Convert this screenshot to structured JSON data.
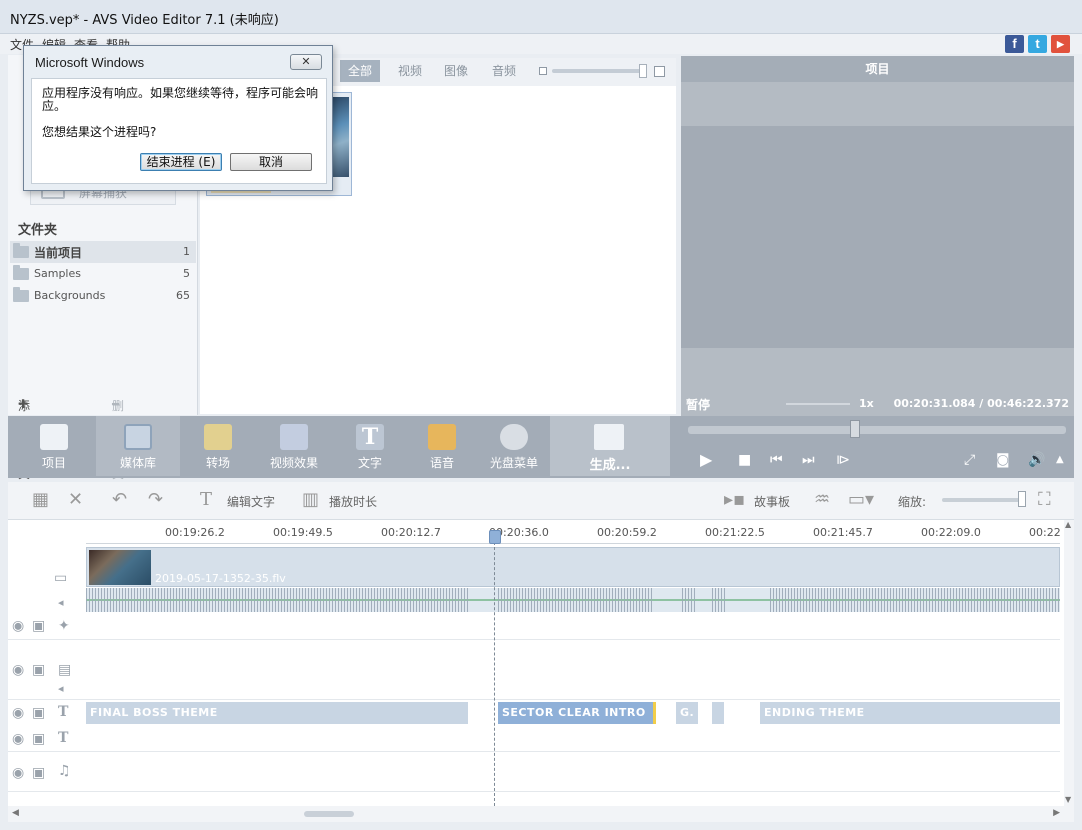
{
  "window": {
    "title": "NYZS.vep* - AVS Video Editor 7.1 (未响应)"
  },
  "menu": [
    "文件",
    "编辑",
    "查看",
    "帮助"
  ],
  "social": [
    {
      "icon": "facebook-icon",
      "glyph": "f",
      "color": "#3b5998"
    },
    {
      "icon": "twitter-icon",
      "glyph": "t",
      "color": "#35a8e0"
    },
    {
      "icon": "youtube-icon",
      "glyph": "▶",
      "color": "#e1523d"
    }
  ],
  "left_panel": {
    "record_button": "屏幕捕获",
    "folders_header": "文件夹",
    "folders": [
      {
        "name": "当前项目",
        "count": "1"
      },
      {
        "name": "Samples",
        "count": "5"
      },
      {
        "name": "Backgrounds",
        "count": "65"
      }
    ],
    "add_folder": "添加文件夹",
    "delete_folder": "删除文件夹"
  },
  "media": {
    "tabs": [
      "全部",
      "视频",
      "图像",
      "音频"
    ]
  },
  "preview": {
    "title": "项目",
    "status": "暂停",
    "speed": "1x",
    "time": "00:20:31.084  /  00:46:22.372"
  },
  "tools": [
    "项目",
    "媒体库",
    "转场",
    "视频效果",
    "文字",
    "语音",
    "光盘菜单"
  ],
  "generate": "生成...",
  "timeline_tools": {
    "edit_text": "编辑文字",
    "duration": "播放时长",
    "storyboard": "故事板",
    "zoom": "缩放:"
  },
  "ruler": [
    "00:19:26.2",
    "00:19:49.5",
    "00:20:12.7",
    "00:20:36.0",
    "00:20:59.2",
    "00:21:22.5",
    "00:21:45.7",
    "00:22:09.0",
    "00:22"
  ],
  "video_clip": "2019-05-17-1352-35.flv",
  "text_clips": [
    "FINAL BOSS THEME",
    "SECTOR CLEAR INTRO",
    "G.",
    "ENDING THEME"
  ],
  "dialog": {
    "title": "Microsoft Windows",
    "close": "✕",
    "message": "应用程序没有响应。如果您继续等待，程序可能会响应。",
    "question": "您想结果这个进程吗?",
    "end_button": "结束进程 (E)",
    "cancel_button": "取消"
  }
}
